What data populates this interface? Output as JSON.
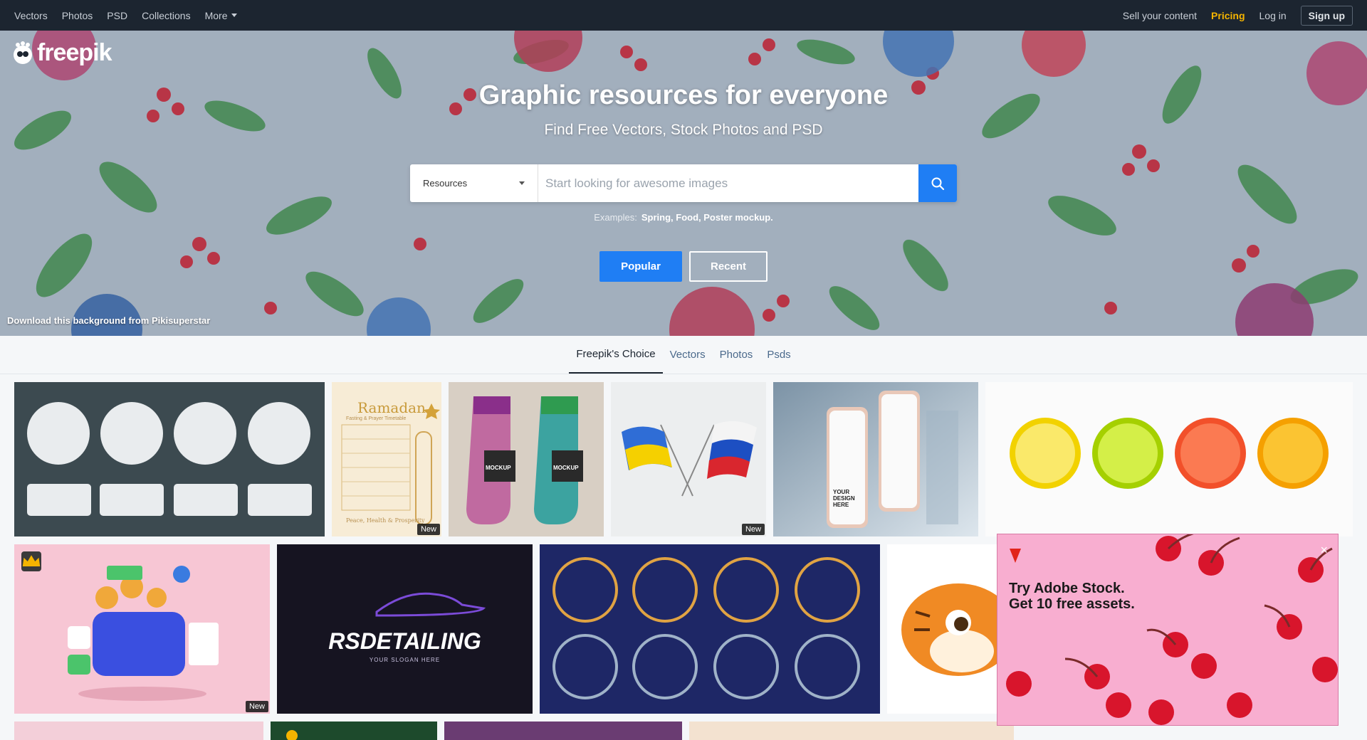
{
  "topnav": {
    "left": [
      {
        "label": "Vectors"
      },
      {
        "label": "Photos"
      },
      {
        "label": "PSD"
      },
      {
        "label": "Collections"
      },
      {
        "label": "More"
      }
    ],
    "sell": "Sell your content",
    "pricing": "Pricing",
    "login": "Log in",
    "signup": "Sign up"
  },
  "brand": {
    "name": "freepik"
  },
  "hero": {
    "title": "Graphic resources for everyone",
    "subtitle": "Find Free Vectors, Stock Photos and PSD",
    "search": {
      "category": "Resources",
      "placeholder": "Start looking for awesome images",
      "value": ""
    },
    "examples_label": "Examples:",
    "examples": "Spring, Food, Poster mockup.",
    "popular_label": "Popular",
    "recent_label": "Recent",
    "credit": "Download this background from Pikisuperstar"
  },
  "tabs": [
    {
      "label": "Freepik's Choice",
      "active": true
    },
    {
      "label": "Vectors"
    },
    {
      "label": "Photos"
    },
    {
      "label": "Psds"
    }
  ],
  "tiles": {
    "ramadan_title": "Ramadan",
    "ramadan_sub": "Fasting & Prayer Timetable",
    "ramadan_foot": "Peace, Health & Prosperity",
    "sock_label_1": "MOCKUP",
    "sock_label_2": "MOCKUP",
    "phone_text": "YOUR DESIGN HERE",
    "rs_brand": "RSDETAILING",
    "rs_slogan": "YOUR SLOGAN HERE",
    "new_badge": "New"
  },
  "ad": {
    "brand": "Adobe",
    "headline_1": "Try Adobe Stock.",
    "headline_2": "Get 10 free assets.",
    "close": "×"
  },
  "colors": {
    "nav_bg": "#1c2530",
    "accent_blue": "#1f7ef4",
    "pricing_yellow": "#f5b400",
    "ad_pink": "#f8aed0"
  }
}
